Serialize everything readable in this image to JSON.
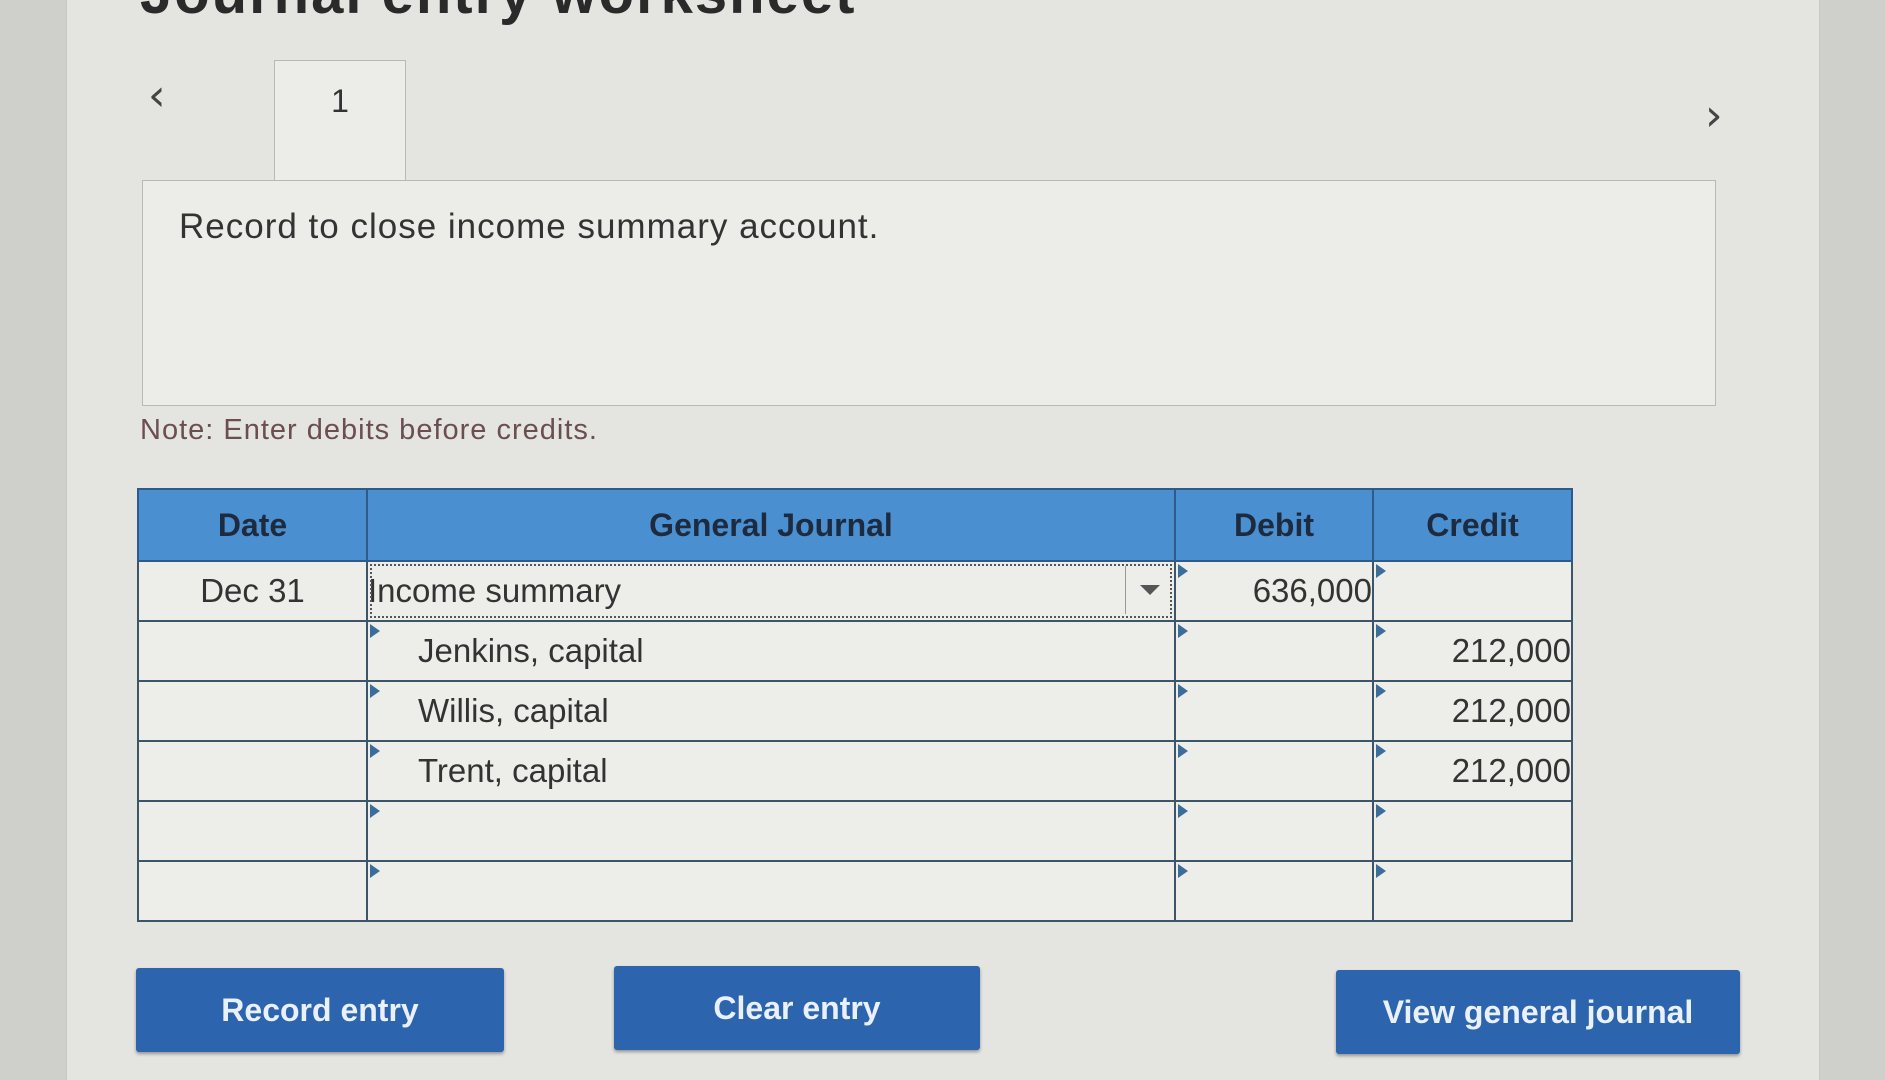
{
  "title": "Journal entry worksheet",
  "nav": {
    "prev_icon": "chevron-left-icon",
    "next_icon": "chevron-right-icon"
  },
  "tabs": [
    {
      "label": "1"
    }
  ],
  "instruction": "Record to close income summary account.",
  "note": "Note: Enter debits before credits.",
  "journal": {
    "headers": {
      "date": "Date",
      "general_journal": "General Journal",
      "debit": "Debit",
      "credit": "Credit"
    },
    "rows": [
      {
        "date": "Dec 31",
        "account": "Income summary",
        "debit": "636,000",
        "credit": ""
      },
      {
        "date": "",
        "account": "Jenkins, capital",
        "debit": "",
        "credit": "212,000"
      },
      {
        "date": "",
        "account": "Willis, capital",
        "debit": "",
        "credit": "212,000"
      },
      {
        "date": "",
        "account": "Trent, capital",
        "debit": "",
        "credit": "212,000"
      },
      {
        "date": "",
        "account": "",
        "debit": "",
        "credit": ""
      },
      {
        "date": "",
        "account": "",
        "debit": "",
        "credit": ""
      }
    ]
  },
  "buttons": {
    "record": "Record entry",
    "clear": "Clear entry",
    "view": "View general journal"
  },
  "colors": {
    "header_bg": "#4a8fd0",
    "button_bg": "#2c64ad",
    "note_text": "#6b4f4f"
  }
}
